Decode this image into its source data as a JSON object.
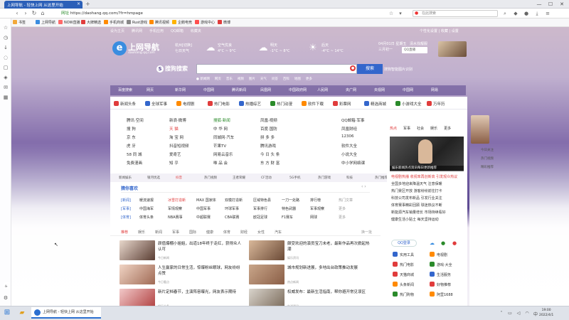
{
  "browser": {
    "tab_title": "上网导航 - 轻快上网 从这里开始",
    "tab_close": "×",
    "new_tab": "+",
    "url_prefix": "网址",
    "url": "https://daohang.qq.com/?fr=hmpage",
    "search_placeholder": "在此搜索",
    "window_min": "—",
    "window_max": "☐",
    "window_close": "✕",
    "bookmarks": [
      {
        "label": "书签",
        "color": "#f2a83a"
      },
      {
        "label": "上网导航",
        "color": "#3a8de0"
      },
      {
        "label": "NOW直播",
        "color": "#ff6a6a"
      },
      {
        "label": "大牌精选",
        "color": "#e03c3c"
      },
      {
        "label": "手机商城",
        "color": "#ff8a00"
      },
      {
        "label": "Rust游戏",
        "color": "#888888"
      },
      {
        "label": "腾讯视频",
        "color": "#ff8a00"
      },
      {
        "label": "企鹅电竞",
        "color": "#ffb300"
      },
      {
        "label": "游戏中心",
        "color": "#ff4f4f"
      },
      {
        "label": "微博",
        "color": "#e03c3c"
      }
    ]
  },
  "page": {
    "top_links": [
      "设为主页",
      "腾讯网",
      "手机应用",
      "QQ邮箱",
      "收藏夹"
    ],
    "top_right": "个性化设置 | 收藏 | 设置",
    "logo": {
      "mark": "e",
      "title": "上网导航",
      "sub": "daohang.qq.com"
    },
    "weather": [
      {
        "city": "杭州[切换]",
        "cond": "七日天气",
        "icon": "☁",
        "temp": "4°C ~ 9°C"
      },
      {
        "city": "空气优良",
        "cond": "明天",
        "icon": "☁",
        "temp": "-1°C ~ 8°C"
      },
      {
        "city": "后天",
        "cond": "多云",
        "icon": "☀",
        "temp": "-4°C ~ 14°C"
      }
    ],
    "calendar": {
      "date": "04月01日 星期五",
      "lunar": "三月初一",
      "extra": "清水找靓服"
    },
    "city_select": "QQ直播",
    "search": {
      "engine": "搜狗搜索",
      "button": "搜索",
      "visual": "搜狗智能图片识别",
      "quick": [
        "● 新闻网",
        "网页",
        "音乐",
        "视频",
        "图片",
        "天气",
        "问答",
        "百科",
        "地图",
        "更多"
      ]
    },
    "categories": [
      "百度搜索",
      "网页",
      "新华网",
      "中国网",
      "腾讯新闻",
      "凤凰网",
      "中国政府网",
      "人民网",
      "央广网",
      "央视网",
      "中国网",
      "网易"
    ],
    "quick_links": [
      {
        "label": "新闻头条",
        "color": "#e03c3c"
      },
      {
        "label": "全球军事",
        "color": "#3366cc"
      },
      {
        "label": "电视剧",
        "color": "#ff8a00"
      },
      {
        "label": "热门电影",
        "color": "#e03c3c"
      },
      {
        "label": "热播综艺",
        "color": "#3366cc"
      },
      {
        "label": "热门动漫",
        "color": "#2a8a2a"
      },
      {
        "label": "软件下载",
        "color": "#ff8a00"
      },
      {
        "label": "彩票网",
        "color": "#e03c3c"
      },
      {
        "label": "精选商城",
        "color": "#3366cc"
      },
      {
        "label": "小游戏大全",
        "color": "#2a8a2a"
      },
      {
        "label": "万年历",
        "color": "#e03c3c"
      }
    ],
    "sites": [
      [
        "腾讯·空间",
        "新浪·微博",
        "搜狐·新闻",
        "凤凰·视频",
        "QQ邮箱·军事"
      ],
      [
        "搜 狗",
        "天 猫",
        "中 华 网",
        "百度·国防",
        "凤凰财经"
      ],
      [
        "京 东",
        "淘 宝 网",
        "同城网·汽车",
        "拼 多 多",
        "12306"
      ],
      [
        "虎 牙",
        "抖音短视频",
        "芒果TV",
        "腾讯游戏",
        "软件大全"
      ],
      [
        "58 同 城",
        "爱奇艺",
        "网易云音乐",
        "今 日 头 条",
        "小说大全"
      ],
      [
        "免费漫画",
        "知 乎",
        "唯 品 会",
        "东 方 财 富",
        "中小学网络课"
      ]
    ],
    "hot_links": [
      "新闻娱乐",
      "银河优选",
      "抖音",
      "热门视频",
      "王者荣耀",
      "CF活动",
      "5G手机",
      "热门游戏",
      "科技",
      "热门推荐",
      "生活",
      "更多"
    ],
    "news_title": "猜你喜欢",
    "news_rows": [
      {
        "tag": "[新闻]",
        "items": [
          "暖流速报",
          "冰雪打造新",
          "MAX 国家体",
          "双模打造新",
          "区域特色县",
          "一刀一处路",
          "排行榜",
          "热门文章"
        ]
      },
      {
        "tag": "[军事]",
        "items": [
          "中国海军",
          "军情观察",
          "中国军事",
          "环球军事",
          "军事排行",
          "特色武器",
          "军事观察",
          "更多"
        ]
      },
      {
        "tag": "[体育]",
        "items": [
          "体育头条",
          "NBA赛事",
          "中超联赛",
          "CBA联赛",
          "欧冠足球",
          "F1赛车",
          "网球",
          "更多"
        ]
      }
    ],
    "feed_tabs": [
      "推荐",
      "娱乐",
      "新闻",
      "军事",
      "国际",
      "健康",
      "体育",
      "财经",
      "女性",
      "汽车"
    ],
    "feed_more": "换一批",
    "feed": [
      {
        "title": "颜值爆棚小姐姐，出道18年终于走红，获得众人认可",
        "src": "今日新闻"
      },
      {
        "title": "颇受欢迎的演员宝刀未老，最新作品再次掀起热潮",
        "src": "娱乐资讯"
      },
      {
        "title": "人生赢家的日常生活，惊爆粉丝眼球，网友纷纷点赞",
        "src": "今日看点"
      },
      {
        "title": "城市规划新进展，多地出台政策推动发展",
        "src": "热点新闻"
      },
      {
        "title": "新片定档春节，主演阵容曝光，网友表示期待",
        "src": "娱乐头条"
      },
      {
        "title": "权威发布：最新生活指南，帮你避开常见误区",
        "src": "生活资讯"
      }
    ],
    "right_tabs": [
      "热点",
      "军事",
      "社会",
      "娱乐",
      "更多"
    ],
    "right_caption": "娱乐新闻热点资讯每日更新推荐",
    "right_news": [
      {
        "text": "电视剧热播 收视率再创新高 引发观众热议",
        "red": true
      },
      {
        "text": "全国多地迎来降温天气 注意保暖",
        "red": false
      },
      {
        "text": "热门景区开放 游客纷纷前往打卡",
        "red": false
      },
      {
        "text": "科技公司发布新品 引发行业关注",
        "red": false
      },
      {
        "text": "体育赛事精彩回顾 球迷热议不断",
        "red": false
      },
      {
        "text": "新能源汽车销量增长 市场持续看好",
        "red": false
      },
      {
        "text": "健康生活小贴士 每天坚持运动",
        "red": false
      }
    ],
    "apps_qq": "QQ登录",
    "apps": [
      {
        "label": "实用工具",
        "color": "#3366cc"
      },
      {
        "label": "电视剧",
        "color": "#ff8a00"
      },
      {
        "label": "热门电影",
        "color": "#e03c3c"
      },
      {
        "label": "游戏·大全",
        "color": "#2a8a2a"
      },
      {
        "label": "天猫商城",
        "color": "#e03c3c"
      },
      {
        "label": "生活服务",
        "color": "#3366cc"
      },
      {
        "label": "头条新闻",
        "color": "#ff8a00"
      },
      {
        "label": "好物推荐",
        "color": "#e03c3c"
      },
      {
        "label": "热门购物",
        "color": "#2a8a2a"
      },
      {
        "label": "阿里1688",
        "color": "#ff8a00"
      }
    ],
    "far_right": [
      "今日关注",
      "热门视频",
      "精彩推荐"
    ]
  },
  "taskbar": {
    "task_title": "上网导航 - 轻快上网 从这里开始",
    "time": "19:00",
    "date": "2022/4/1"
  }
}
